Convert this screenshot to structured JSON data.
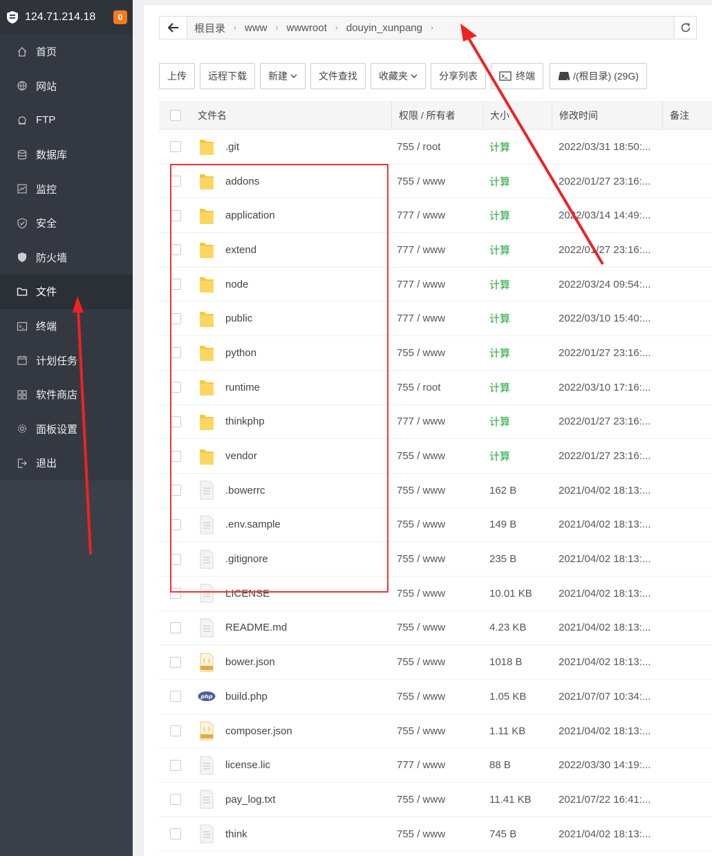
{
  "sidebar": {
    "ip": "124.71.214.18",
    "badge": "0",
    "items": [
      {
        "label": "首页",
        "icon": "home-icon"
      },
      {
        "label": "网站",
        "icon": "globe-icon"
      },
      {
        "label": "FTP",
        "icon": "ftp-icon"
      },
      {
        "label": "数据库",
        "icon": "database-icon"
      },
      {
        "label": "监控",
        "icon": "monitor-icon"
      },
      {
        "label": "安全",
        "icon": "shield-check-icon"
      },
      {
        "label": "防火墙",
        "icon": "firewall-icon"
      },
      {
        "label": "文件",
        "icon": "folder-icon"
      },
      {
        "label": "终端",
        "icon": "terminal-icon"
      },
      {
        "label": "计划任务",
        "icon": "calendar-icon"
      },
      {
        "label": "软件商店",
        "icon": "grid-icon"
      },
      {
        "label": "面板设置",
        "icon": "gear-icon"
      },
      {
        "label": "退出",
        "icon": "logout-icon"
      }
    ],
    "active_index": 7
  },
  "breadcrumb": [
    "根目录",
    "www",
    "wwwroot",
    "douyin_xunpang"
  ],
  "toolbar": {
    "upload": "上传",
    "remote_download": "远程下载",
    "new": "新建",
    "file_search": "文件查找",
    "favorites": "收藏夹",
    "share_list": "分享列表",
    "terminal": "终端",
    "disk": "/(根目录) (29G)"
  },
  "table": {
    "headers": {
      "name": "文件名",
      "perm": "权限 / 所有者",
      "size": "大小",
      "mtime": "修改时间",
      "note": "备注"
    },
    "rows": [
      {
        "name": ".git",
        "type": "folder",
        "perm": "755 / root",
        "size": "计算",
        "mtime": "2022/03/31 18:50:..."
      },
      {
        "name": "addons",
        "type": "folder",
        "perm": "755 / www",
        "size": "计算",
        "mtime": "2022/01/27 23:16:..."
      },
      {
        "name": "application",
        "type": "folder",
        "perm": "777 / www",
        "size": "计算",
        "mtime": "2022/03/14 14:49:..."
      },
      {
        "name": "extend",
        "type": "folder",
        "perm": "777 / www",
        "size": "计算",
        "mtime": "2022/01/27 23:16:..."
      },
      {
        "name": "node",
        "type": "folder",
        "perm": "777 / www",
        "size": "计算",
        "mtime": "2022/03/24 09:54:..."
      },
      {
        "name": "public",
        "type": "folder",
        "perm": "777 / www",
        "size": "计算",
        "mtime": "2022/03/10 15:40:..."
      },
      {
        "name": "python",
        "type": "folder",
        "perm": "755 / www",
        "size": "计算",
        "mtime": "2022/01/27 23:16:..."
      },
      {
        "name": "runtime",
        "type": "folder",
        "perm": "755 / root",
        "size": "计算",
        "mtime": "2022/03/10 17:16:..."
      },
      {
        "name": "thinkphp",
        "type": "folder",
        "perm": "777 / www",
        "size": "计算",
        "mtime": "2022/01/27 23:16:..."
      },
      {
        "name": "vendor",
        "type": "folder",
        "perm": "755 / www",
        "size": "计算",
        "mtime": "2022/01/27 23:16:..."
      },
      {
        "name": ".bowerrc",
        "type": "file",
        "perm": "755 / www",
        "size": "162 B",
        "mtime": "2021/04/02 18:13:..."
      },
      {
        "name": ".env.sample",
        "type": "file",
        "perm": "755 / www",
        "size": "149 B",
        "mtime": "2021/04/02 18:13:..."
      },
      {
        "name": ".gitignore",
        "type": "file",
        "perm": "755 / www",
        "size": "235 B",
        "mtime": "2021/04/02 18:13:..."
      },
      {
        "name": "LICENSE",
        "type": "file",
        "perm": "755 / www",
        "size": "10.01 KB",
        "mtime": "2021/04/02 18:13:..."
      },
      {
        "name": "README.md",
        "type": "file",
        "perm": "755 / www",
        "size": "4.23 KB",
        "mtime": "2021/04/02 18:13:..."
      },
      {
        "name": "bower.json",
        "type": "json",
        "perm": "755 / www",
        "size": "1018 B",
        "mtime": "2021/04/02 18:13:..."
      },
      {
        "name": "build.php",
        "type": "php",
        "perm": "755 / www",
        "size": "1.05 KB",
        "mtime": "2021/07/07 10:34:..."
      },
      {
        "name": "composer.json",
        "type": "json",
        "perm": "755 / www",
        "size": "1.11 KB",
        "mtime": "2021/04/02 18:13:..."
      },
      {
        "name": "license.lic",
        "type": "file",
        "perm": "777 / www",
        "size": "88 B",
        "mtime": "2022/03/30 14:19:..."
      },
      {
        "name": "pay_log.txt",
        "type": "file",
        "perm": "755 / www",
        "size": "11.41 KB",
        "mtime": "2021/07/22 16:41:..."
      },
      {
        "name": "think",
        "type": "file",
        "perm": "755 / www",
        "size": "745 B",
        "mtime": "2021/04/02 18:13:..."
      }
    ]
  },
  "colors": {
    "accent_green": "#20a53a",
    "annotation_red": "#e33333",
    "sidebar_bg": "#3a4049",
    "badge_orange": "#f37b1d"
  }
}
